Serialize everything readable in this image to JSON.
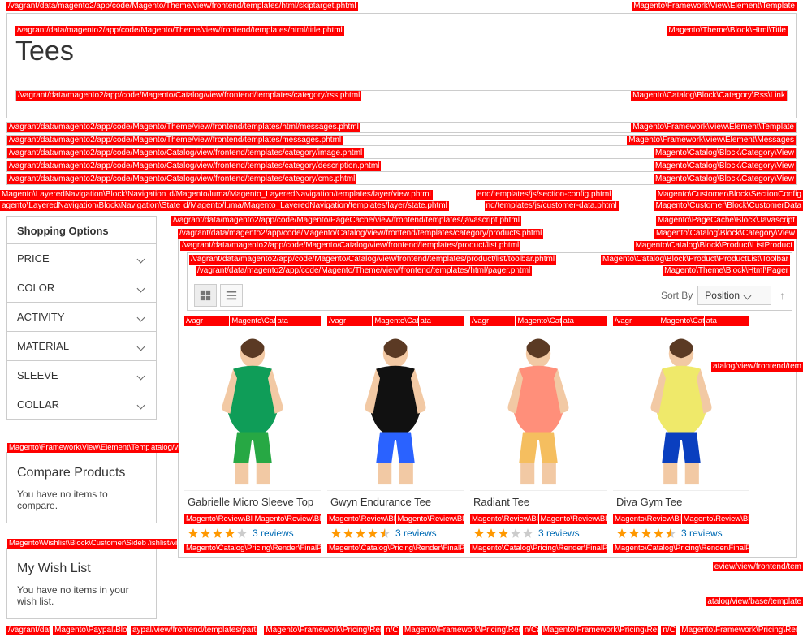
{
  "hints": {
    "top1": {
      "left": "/vagrant/data/magento2/app/code/Magento/Theme/view/frontend/templates/html/skiptarget.phtml",
      "right": "Magento\\Framework\\View\\Element\\Template"
    },
    "title_box": {
      "left": "/vagrant/data/magento2/app/code/Magento/Theme/view/frontend/templates/html/title.phtml",
      "right": "Magento\\Theme\\Block\\Html\\Title"
    },
    "rss_box": {
      "left": "/vagrant/data/magento2/app/code/Magento/Catalog/view/frontend/templates/category/rss.phtml",
      "right": "Magento\\Catalog\\Block\\Category\\Rss\\Link"
    },
    "row_messages1": {
      "left": "/vagrant/data/magento2/app/code/Magento/Theme/view/frontend/templates/html/messages.phtml",
      "right": "Magento\\Framework\\View\\Element\\Template"
    },
    "row_messages2": {
      "left": "/vagrant/data/magento2/app/code/Magento/Theme/view/frontend/templates/messages.phtml",
      "right": "Magento\\Framework\\View\\Element\\Messages"
    },
    "row_catimg": {
      "left": "/vagrant/data/magento2/app/code/Magento/Catalog/view/frontend/templates/category/image.phtml",
      "right": "Magento\\Catalog\\Block\\Category\\View"
    },
    "row_catdesc": {
      "left": "/vagrant/data/magento2/app/code/Magento/Catalog/view/frontend/templates/category/description.phtml",
      "right": "Magento\\Catalog\\Block\\Category\\View"
    },
    "row_catcms": {
      "left": "/vagrant/data/magento2/app/code/Magento/Catalog/view/frontend/templates/category/cms.phtml",
      "right": "Magento\\Catalog\\Block\\Category\\View"
    },
    "nav1": {
      "left": "Magento\\LayeredNavigation\\Block\\Navigation",
      "mid": "d/Magento/luma/Magento_LayeredNavigation/templates/layer/view.phtml",
      "mid2": "end/templates/js/section-config.phtml",
      "right": "Magento\\Customer\\Block\\SectionConfig"
    },
    "nav2": {
      "left": "agento\\LayeredNavigation\\Block\\Navigation\\State",
      "mid": "d/Magento/luma/Magento_LayeredNavigation/templates/layer/state.phtml",
      "mid2": "nd/templates/js/customer-data.phtml",
      "right": "Magento\\Customer\\Block\\CustomerData"
    },
    "main_js": {
      "left": "/vagrant/data/magento2/app/code/Magento/PageCache/view/frontend/templates/javascript.phtml",
      "right": "Magento\\PageCache\\Block\\Javascript"
    },
    "main_products": {
      "left": "/vagrant/data/magento2/app/code/Magento/Catalog/view/frontend/templates/category/products.phtml",
      "right": "Magento\\Catalog\\Block\\Category\\View"
    },
    "main_list": {
      "left": "/vagrant/data/magento2/app/code/Magento/Catalog/view/frontend/templates/product/list.phtml",
      "right": "Magento\\Catalog\\Block\\Product\\ListProduct"
    },
    "main_toolbar": {
      "left": "/vagrant/data/magento2/app/code/Magento/Catalog/view/frontend/templates/product/list/toolbar.phtml",
      "right": "Magento\\Catalog\\Block\\Product\\ProductList\\Toolbar"
    },
    "main_pager": {
      "left": "/vagrant/data/magento2/app/code/Magento/Theme/view/frontend/templates/html/pager.phtml",
      "right": "Magento\\Theme\\Block\\Html\\Pager"
    },
    "compare_block_left": "Magento\\Framework\\View\\Element\\Template",
    "compare_block_right": "atalog/vi",
    "wishlist_left": "Magento\\Wishlist\\Block\\Customer\\Sidebar",
    "wishlist_right": "/ishlist/vi",
    "prod_img_left": "/vagr",
    "prod_img_class": "Magento\\Catalog\\Block\\Product\\Image",
    "prod_img_right": "ata",
    "prod_review_l": "Magento\\Review\\Block\\Product\\ReviewRenderer",
    "prod_review_r": "Magento\\Review\\Block\\Product\\Review\\Renderer",
    "price_class": "Magento\\Catalog\\Pricing\\Render\\FinalPriceBox",
    "amount_class": "Magento\\Framework\\Pricing\\Render\\Amount",
    "amount_frag": "n/Ca",
    "edge_right_1": "atalog/view/frontend/tem",
    "edge_right_2": "eview/view/frontend/tem",
    "edge_right_3": "atalog/view/base/template",
    "bottom_left1": "/vagrant/data/m",
    "bottom_left2": "Magento\\Paypal\\Block\\Logo",
    "bottom_left3": "aypal/view/frontend/templates/partner/logo.phtml"
  },
  "title": "Tees",
  "filters": {
    "heading": "Shopping Options",
    "items": [
      "PRICE",
      "COLOR",
      "ACTIVITY",
      "MATERIAL",
      "SLEEVE",
      "COLLAR"
    ]
  },
  "compare": {
    "title": "Compare Products",
    "empty": "You have no items to compare."
  },
  "wishlist": {
    "title": "My Wish List",
    "empty": "You have no items in your wish list."
  },
  "toolbar": {
    "sort_label": "Sort By",
    "sort_value": "Position"
  },
  "products": [
    {
      "name": "Gabrielle Micro Sleeve Top",
      "reviews_text": "3 reviews",
      "rating": 4.0,
      "shirt": "#0f9d58",
      "shorts": "#27a844"
    },
    {
      "name": "Gwyn Endurance Tee",
      "reviews_text": "3 reviews",
      "rating": 4.5,
      "shirt": "#111111",
      "shorts": "#2a62ff"
    },
    {
      "name": "Radiant Tee",
      "reviews_text": "3 reviews",
      "rating": 3.0,
      "shirt": "#ff8f7a",
      "shorts": "#f5be5f"
    },
    {
      "name": "Diva Gym Tee",
      "reviews_text": "3 reviews",
      "rating": 4.5,
      "shirt": "#efe96a",
      "shorts": "#0a3fbf"
    }
  ]
}
